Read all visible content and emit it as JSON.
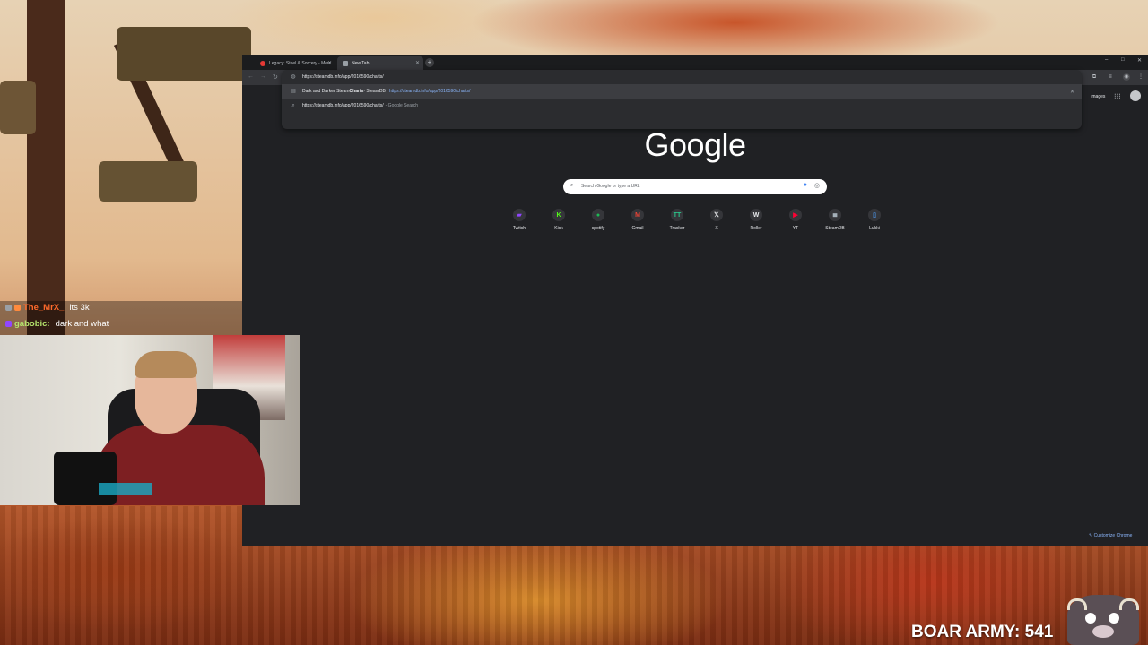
{
  "browser": {
    "tabs": [
      {
        "title": "Legacy: Steel & Sorcery - Merc",
        "favicon_color": "#e53935",
        "active": false
      },
      {
        "title": "New Tab",
        "favicon_color": "#bdc1c6",
        "active": true
      }
    ],
    "new_tab_label": "+",
    "window_controls": {
      "minimize": "–",
      "maximize": "□",
      "close": "✕"
    },
    "omnibox": {
      "input_value": "https://steamdb.info/app/2016590/charts/",
      "suggestions": [
        {
          "title_pre": "Dark and Darker Steam ",
          "title_bold": "Charts",
          "title_post": " · SteamDB",
          "url": "https://steamdb.info/app/2016590/charts/"
        },
        {
          "query": "https://steamdb.info/app/2016590/charts/",
          "suffix": "- Google Search"
        }
      ]
    },
    "header_links": {
      "images": "Images"
    },
    "logo": "Google",
    "search_placeholder": "Search Google or type a URL",
    "shortcuts": [
      {
        "label": "Twitch",
        "glyph": "▰",
        "color": "#9146ff"
      },
      {
        "label": "Kick",
        "glyph": "K",
        "color": "#53fc18"
      },
      {
        "label": "spotify",
        "glyph": "●",
        "color": "#1db954"
      },
      {
        "label": "Gmail",
        "glyph": "M",
        "color": "#ea4335"
      },
      {
        "label": "Tracker",
        "glyph": "TT",
        "color": "#2bc48a"
      },
      {
        "label": "X",
        "glyph": "𝕏",
        "color": "#e8eaed"
      },
      {
        "label": "Roller",
        "glyph": "W",
        "color": "#e8eaed"
      },
      {
        "label": "YT",
        "glyph": "▶",
        "color": "#ff0033"
      },
      {
        "label": "SteamDB",
        "glyph": "≣",
        "color": "#c6d4df"
      },
      {
        "label": "Lukki",
        "glyph": "▯",
        "color": "#4a90e2"
      }
    ],
    "customize_label": "Customize Chrome"
  },
  "chat": [
    {
      "user": "The_MrX_",
      "message": "its 3k",
      "user_color": "#ff6a2b",
      "badge_color": "#9aa0a6"
    },
    {
      "user": "gabobic:",
      "message": "dark and what",
      "user_color": "#b4e36c",
      "badge_color": "#9146ff"
    }
  ],
  "counter": {
    "label": "BOAR ARMY: 541"
  }
}
